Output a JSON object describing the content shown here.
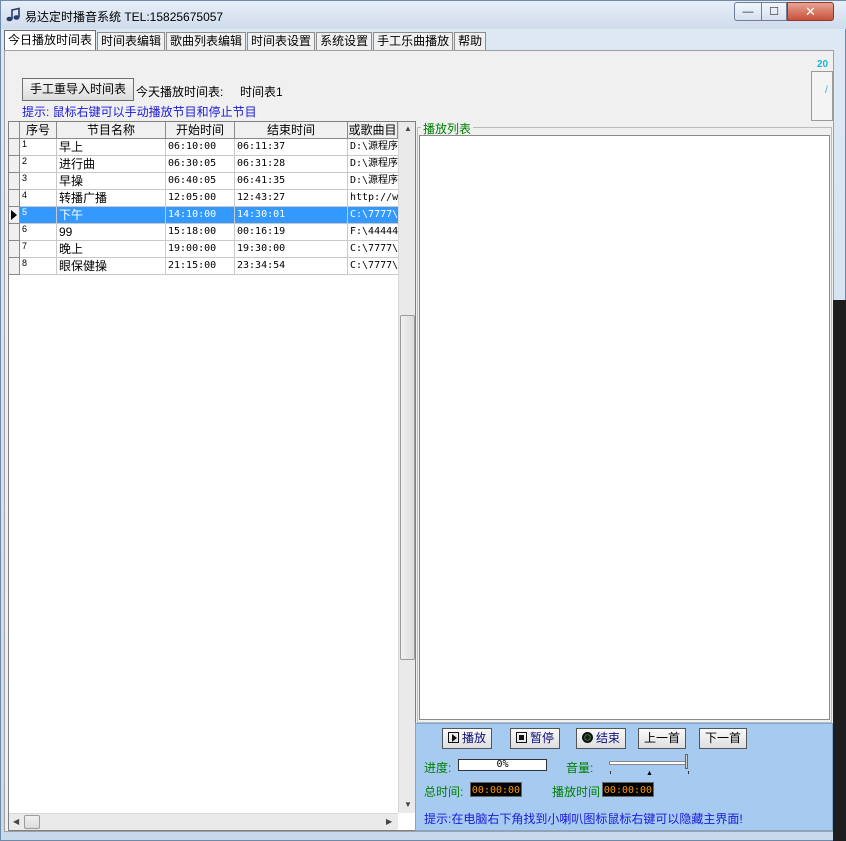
{
  "window": {
    "title": "易达定时播音系统  TEL:15825675057",
    "min_glyph": "—",
    "max_glyph": "☐",
    "close_glyph": "✕"
  },
  "tabs": [
    {
      "label": "今日播放时间表",
      "active": true
    },
    {
      "label": "时间表编辑",
      "active": false
    },
    {
      "label": "歌曲列表编辑",
      "active": false
    },
    {
      "label": "时间表设置",
      "active": false
    },
    {
      "label": "系统设置",
      "active": false
    },
    {
      "label": "手工乐曲播放",
      "active": false
    },
    {
      "label": "帮助",
      "active": false
    }
  ],
  "top_panel": {
    "reimport_button": "手工重导入时间表",
    "today_schedule_label": "今天播放时间表:",
    "today_schedule_value": "时间表1",
    "hint": "提示: 鼠标右键可以手动播放节目和停止节目",
    "corner_text": "20",
    "corner_mark": "/"
  },
  "schedule_table": {
    "columns": [
      "序号",
      "节目名称",
      "开始时间",
      "结束时间",
      "或歌曲目"
    ],
    "selected_index": 4,
    "rows": [
      {
        "no": "1",
        "name": "早上",
        "start": "06:10:00",
        "end": "06:11:37",
        "path": "D:\\源程序"
      },
      {
        "no": "2",
        "name": "进行曲",
        "start": "06:30:05",
        "end": "06:31:28",
        "path": "D:\\源程序"
      },
      {
        "no": "3",
        "name": "早操",
        "start": "06:40:05",
        "end": "06:41:35",
        "path": "D:\\源程序"
      },
      {
        "no": "4",
        "name": "转播广播",
        "start": "12:05:00",
        "end": "12:43:27",
        "path": "http://w"
      },
      {
        "no": "5",
        "name": "下午",
        "start": "14:10:00",
        "end": "14:30:01",
        "path": "C:\\7777\\"
      },
      {
        "no": "6",
        "name": "99",
        "start": "15:18:00",
        "end": "00:16:19",
        "path": "F:\\44444"
      },
      {
        "no": "7",
        "name": "晚上",
        "start": "19:00:00",
        "end": "19:30:00",
        "path": "C:\\7777\\"
      },
      {
        "no": "8",
        "name": "眼保健操",
        "start": "21:15:00",
        "end": "23:34:54",
        "path": "C:\\7777\\"
      }
    ]
  },
  "playlist": {
    "title": "播放列表"
  },
  "controls": {
    "play": "播放",
    "pause": "暂停",
    "stop": "结束",
    "prev": "上一首",
    "next": "下一首",
    "progress_label": "进度:",
    "progress_text": "0%",
    "progress_value": 0,
    "volume_label": "音量:",
    "volume_value": 1.0,
    "total_time_label": "总时间:",
    "total_time": "00:00:00",
    "play_time_label": "播放时间",
    "play_time": "00:00:00",
    "hint": "提示:在电脑右下角找到小喇叭图标鼠标右键可以隐藏主界面!"
  },
  "colors": {
    "selection": "#3399ff",
    "hint_blue": "#1a1adb",
    "label_green": "#008000",
    "time_display": "#ff9a00",
    "control_panel": "#a6caf0"
  }
}
